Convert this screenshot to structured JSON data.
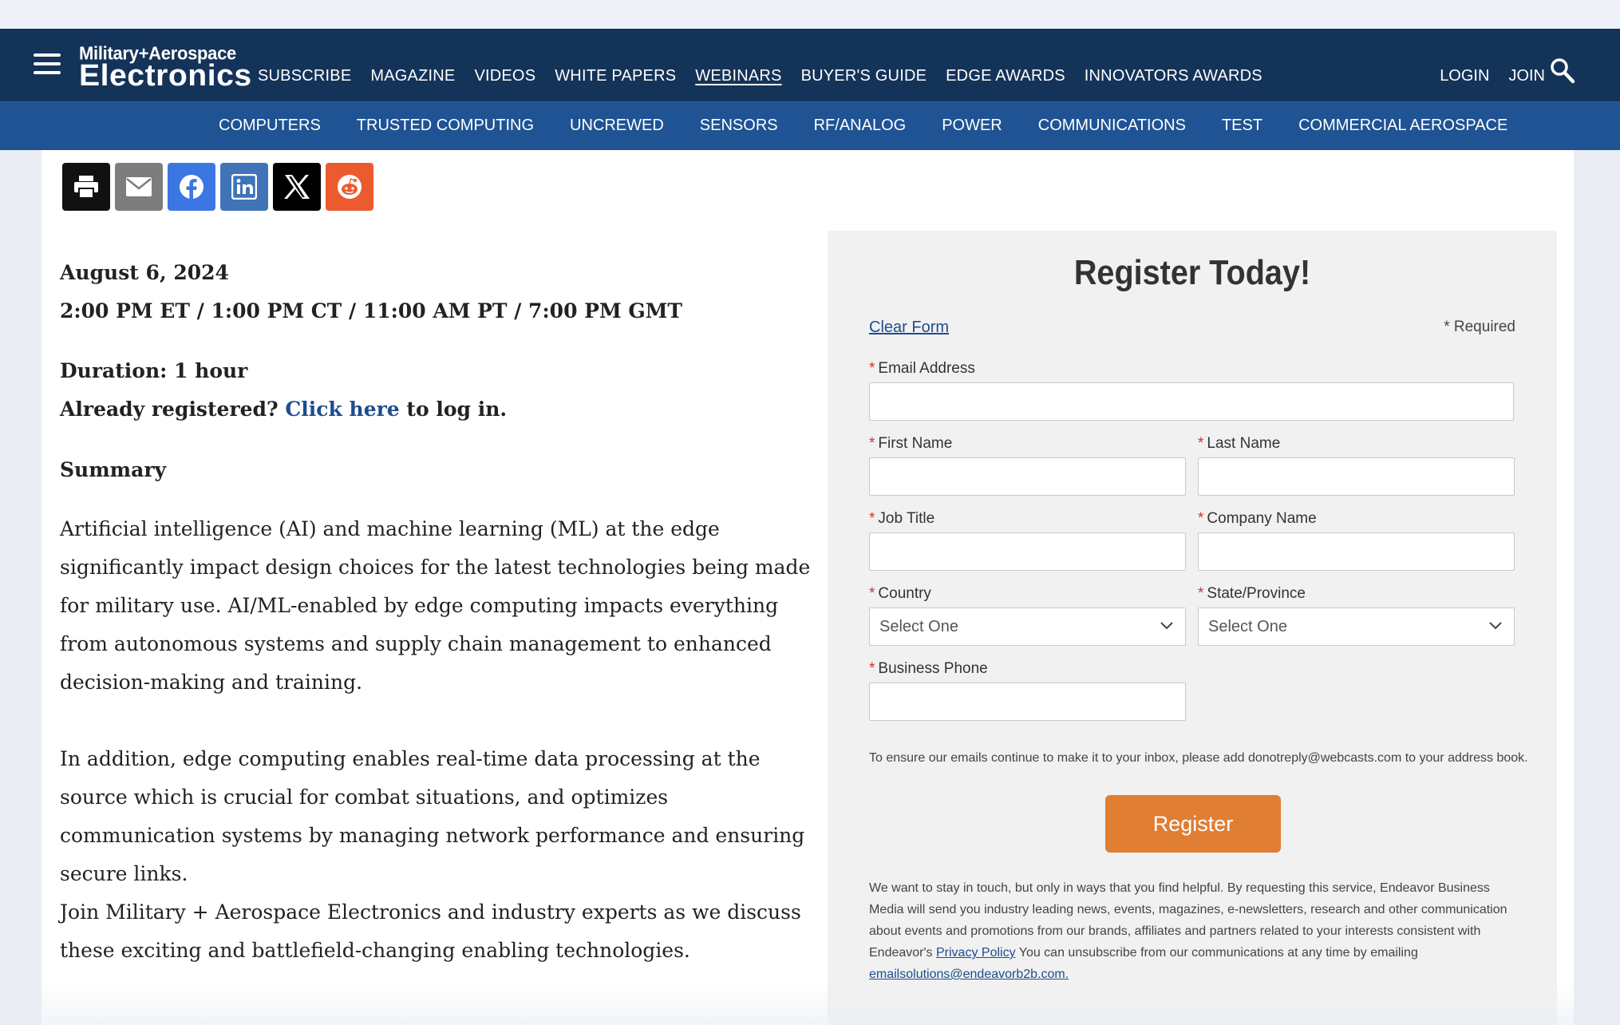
{
  "top_strip": {
    "text": ""
  },
  "header": {
    "logo_line1": "Military+Aerospace",
    "logo_line2": "Electronics",
    "nav": [
      {
        "label": "SUBSCRIBE"
      },
      {
        "label": "MAGAZINE"
      },
      {
        "label": "VIDEOS"
      },
      {
        "label": "WHITE PAPERS"
      },
      {
        "label": "WEBINARS",
        "active": true
      },
      {
        "label": "BUYER'S GUIDE"
      },
      {
        "label": "EDGE AWARDS"
      },
      {
        "label": "INNOVATORS AWARDS"
      }
    ],
    "login": "LOGIN",
    "join": "JOIN"
  },
  "subnav": [
    "COMPUTERS",
    "TRUSTED COMPUTING",
    "UNCREWED",
    "SENSORS",
    "RF/ANALOG",
    "POWER",
    "COMMUNICATIONS",
    "TEST",
    "COMMERCIAL AEROSPACE"
  ],
  "share": [
    {
      "icon": "print-icon",
      "color": "#111111"
    },
    {
      "icon": "email-icon",
      "color": "#7d7d7d"
    },
    {
      "icon": "facebook-icon",
      "color": "#3b77e2"
    },
    {
      "icon": "linkedin-icon",
      "color": "#3f74b6"
    },
    {
      "icon": "x-icon",
      "color": "#000000"
    },
    {
      "icon": "reddit-icon",
      "color": "#ec5b2f"
    }
  ],
  "event": {
    "date": "August 6, 2024",
    "time": "2:00 PM ET / 1:00 PM CT / 11:00 AM PT / 7:00 PM GMT",
    "duration": "Duration: 1 hour",
    "already_prefix": "Already registered?",
    "click_here": "Click here",
    "already_suffix": "to log in.",
    "summary_heading": "Summary",
    "para1": "Artificial intelligence (AI) and machine learning (ML) at the edge significantly impact design choices for the latest technologies being made for military use. AI/ML-enabled by edge computing impacts everything from autonomous systems and supply chain management to enhanced decision-making and training.",
    "para2": "In addition, edge computing enables real-time data processing at the source which is crucial for combat situations, and optimizes communication systems by managing network performance and ensuring secure links.",
    "para3": "Join Military + Aerospace Electronics and industry experts as we discuss these exciting and battlefield-changing enabling technologies."
  },
  "form": {
    "title": "Register Today!",
    "clear": "Clear Form",
    "required": "* Required",
    "star": "*",
    "email_label": "Email Address",
    "first_label": "First Name",
    "last_label": "Last Name",
    "job_label": "Job Title",
    "company_label": "Company Name",
    "country_label": "Country",
    "state_label": "State/Province",
    "phone_label": "Business Phone",
    "select_placeholder": "Select One",
    "note": "To ensure our emails continue to make it to your inbox, please add donotreply@webcasts.com to your address book.",
    "register": "Register",
    "legal_text": "We want to stay in touch, but only in ways that you find helpful. By requesting this service, Endeavor Business Media will send you industry leading news, events, magazines, e-newsletters, research and other communication about events and promotions from our brands, affiliates and partners related to your interests consistent with Endeavor's",
    "privacy_link": "Privacy Policy",
    "legal_text2": "You can unsubscribe from our communications at any time by emailing",
    "email_link": "emailsolutions@endeavorb2b.com."
  }
}
